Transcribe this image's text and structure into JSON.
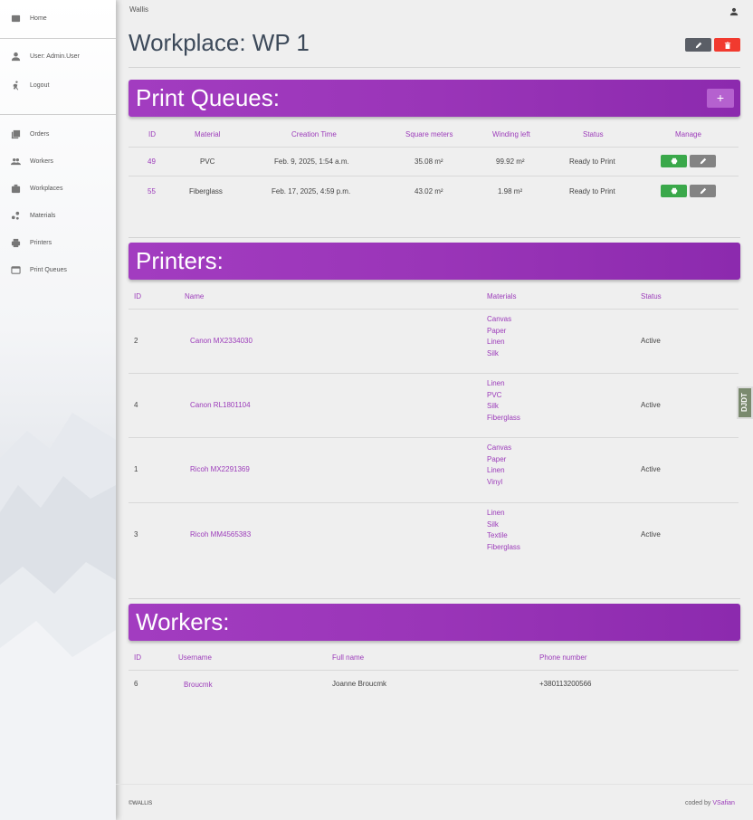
{
  "sidebar": {
    "items": [
      {
        "label": "Home",
        "icon": "home-icon"
      },
      {
        "label": "User: Admin.User",
        "icon": "person-icon"
      },
      {
        "label": "Logout",
        "icon": "logout-run-icon"
      },
      {
        "label": "Orders",
        "icon": "orders-icon"
      },
      {
        "label": "Workers",
        "icon": "workers-group-icon"
      },
      {
        "label": "Workplaces",
        "icon": "workplaces-briefcase-icon"
      },
      {
        "label": "Materials",
        "icon": "materials-icon"
      },
      {
        "label": "Printers",
        "icon": "printer-icon"
      },
      {
        "label": "Print Queues",
        "icon": "print-queues-icon"
      }
    ]
  },
  "topbar": {
    "brand": "Wallis"
  },
  "page": {
    "title": "Workplace: WP 1"
  },
  "colors": {
    "accent": "#9c3cba",
    "header_gradient_start": "#a23cc0",
    "header_gradient_end": "#8c2aae",
    "print_green": "#3aa84a",
    "delete_red": "#f13a2f",
    "edit_gray": "#838383"
  },
  "print_queues": {
    "title": "Print Queues:",
    "add_label": "+",
    "headers": [
      "ID",
      "Material",
      "Creation Time",
      "Square meters",
      "Winding left",
      "Status",
      "Manage"
    ],
    "rows": [
      {
        "id": "49",
        "material": "PVC",
        "created": "Feb. 9, 2025, 1:54 a.m.",
        "sqm": "35.08 m²",
        "winding": "99.92 m²",
        "status": "Ready to Print"
      },
      {
        "id": "55",
        "material": "Fiberglass",
        "created": "Feb. 17, 2025, 4:59 p.m.",
        "sqm": "43.02 m²",
        "winding": "1.98 m²",
        "status": "Ready to Print"
      }
    ]
  },
  "printers": {
    "title": "Printers:",
    "headers": [
      "ID",
      "Name",
      "Materials",
      "Status"
    ],
    "rows": [
      {
        "id": "2",
        "name": "Canon MX2334030",
        "materials": [
          "Canvas",
          "Paper",
          "Linen",
          "Silk"
        ],
        "status": "Active"
      },
      {
        "id": "4",
        "name": "Canon RL1801104",
        "materials": [
          "Linen",
          "PVC",
          "Silk",
          "Fiberglass"
        ],
        "status": "Active"
      },
      {
        "id": "1",
        "name": "Ricoh MX2291369",
        "materials": [
          "Canvas",
          "Paper",
          "Linen",
          "Vinyl"
        ],
        "status": "Active"
      },
      {
        "id": "3",
        "name": "Ricoh MM4565383",
        "materials": [
          "Linen",
          "Silk",
          "Textile",
          "Fiberglass"
        ],
        "status": "Active"
      }
    ]
  },
  "workers": {
    "title": "Workers:",
    "headers": [
      "ID",
      "Username",
      "Full name",
      "Phone number"
    ],
    "rows": [
      {
        "id": "6",
        "username": "Broucmk",
        "fullname": "Joanne Broucmk",
        "phone": "+380113200566"
      }
    ]
  },
  "debug_tab": "DJDT",
  "footer": {
    "left": "©WALLIS",
    "right_prefix": "coded by ",
    "right_link": "VSafian"
  }
}
